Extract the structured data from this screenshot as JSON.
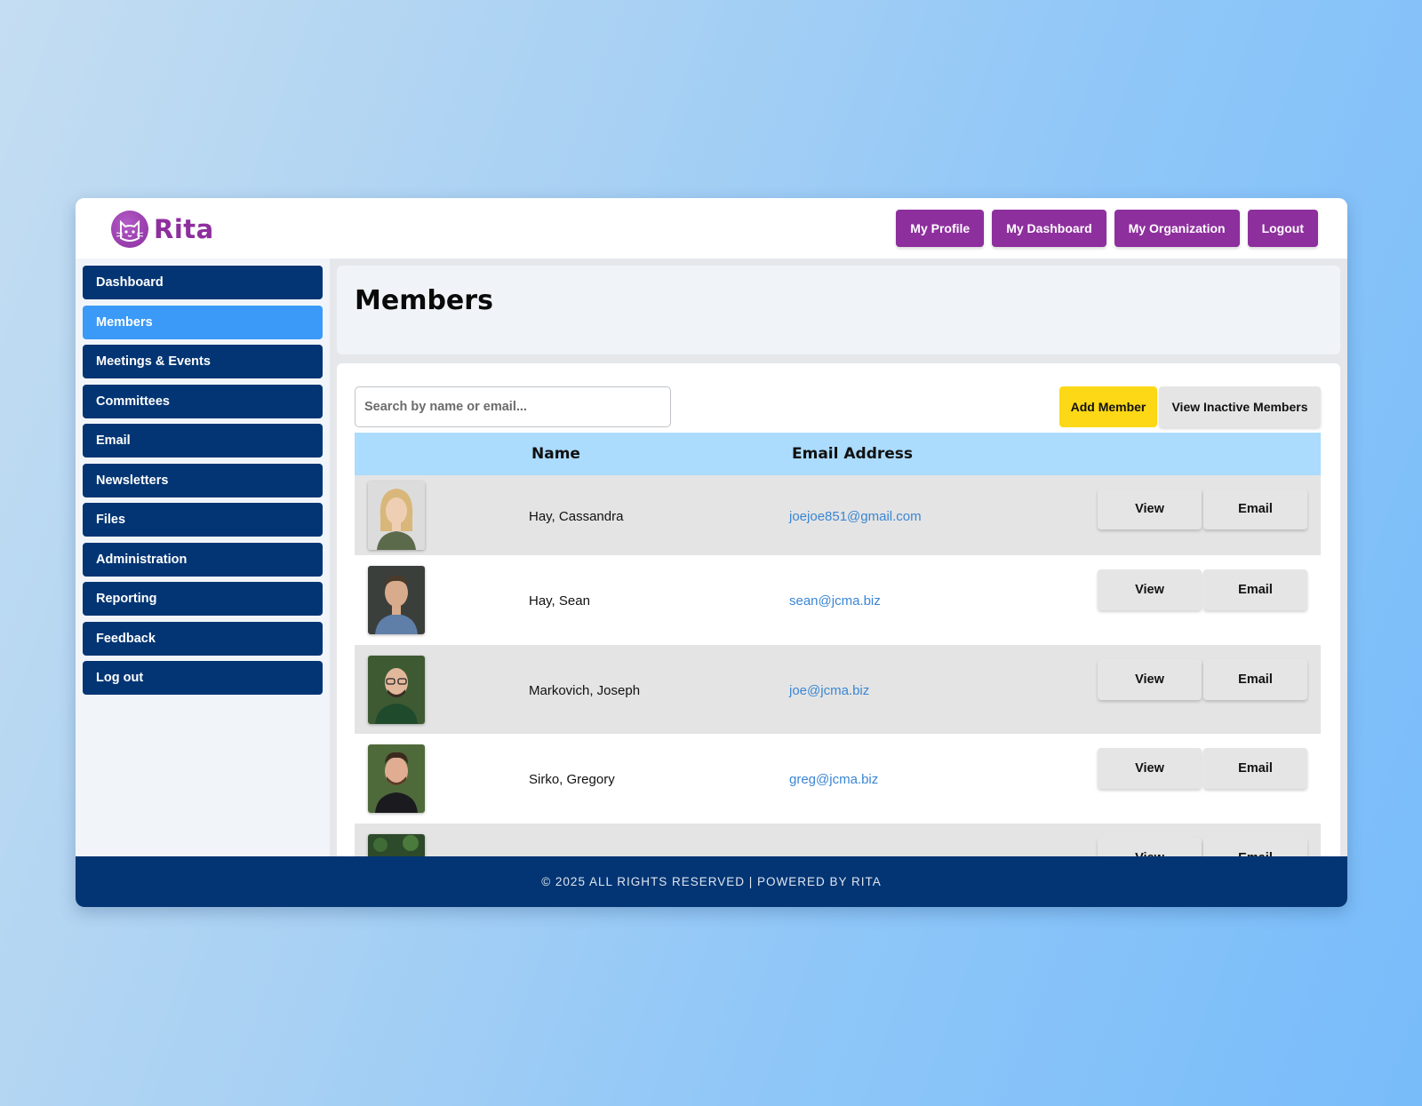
{
  "brand": {
    "name": "Rita",
    "color": "#8e2f9e"
  },
  "topnav": [
    {
      "label": "My Profile"
    },
    {
      "label": "My Dashboard"
    },
    {
      "label": "My Organization"
    },
    {
      "label": "Logout"
    }
  ],
  "sidebar": {
    "items": [
      {
        "label": "Dashboard"
      },
      {
        "label": "Members",
        "active": true
      },
      {
        "label": "Meetings & Events"
      },
      {
        "label": "Committees"
      },
      {
        "label": "Email"
      },
      {
        "label": "Newsletters"
      },
      {
        "label": "Files"
      },
      {
        "label": "Administration"
      },
      {
        "label": "Reporting"
      },
      {
        "label": "Feedback"
      },
      {
        "label": "Log out"
      }
    ]
  },
  "page": {
    "title": "Members"
  },
  "toolbar": {
    "search_placeholder": "Search by name or email...",
    "add_label": "Add Member",
    "inactive_label": "View Inactive Members"
  },
  "table": {
    "headers": {
      "name": "Name",
      "email": "Email Address"
    },
    "rows": [
      {
        "name": "Hay, Cassandra",
        "email": "joejoe851@gmail.com",
        "view": "View",
        "email_btn": "Email"
      },
      {
        "name": "Hay, Sean",
        "email": "sean@jcma.biz",
        "view": "View",
        "email_btn": "Email"
      },
      {
        "name": "Markovich, Joseph",
        "email": "joe@jcma.biz",
        "view": "View",
        "email_btn": "Email"
      },
      {
        "name": "Sirko, Gregory",
        "email": "greg@jcma.biz",
        "view": "View",
        "email_btn": "Email"
      },
      {
        "name": "",
        "email": "",
        "view": "View",
        "email_btn": "Email"
      }
    ]
  },
  "footer": {
    "text": "© 2025 ALL RIGHTS RESERVED | POWERED BY RITA"
  },
  "colors": {
    "navy": "#033574",
    "active": "#3b9af8",
    "accent_yellow": "#fdd816",
    "header_blue": "#abdbfd",
    "link": "#3a86d4"
  }
}
